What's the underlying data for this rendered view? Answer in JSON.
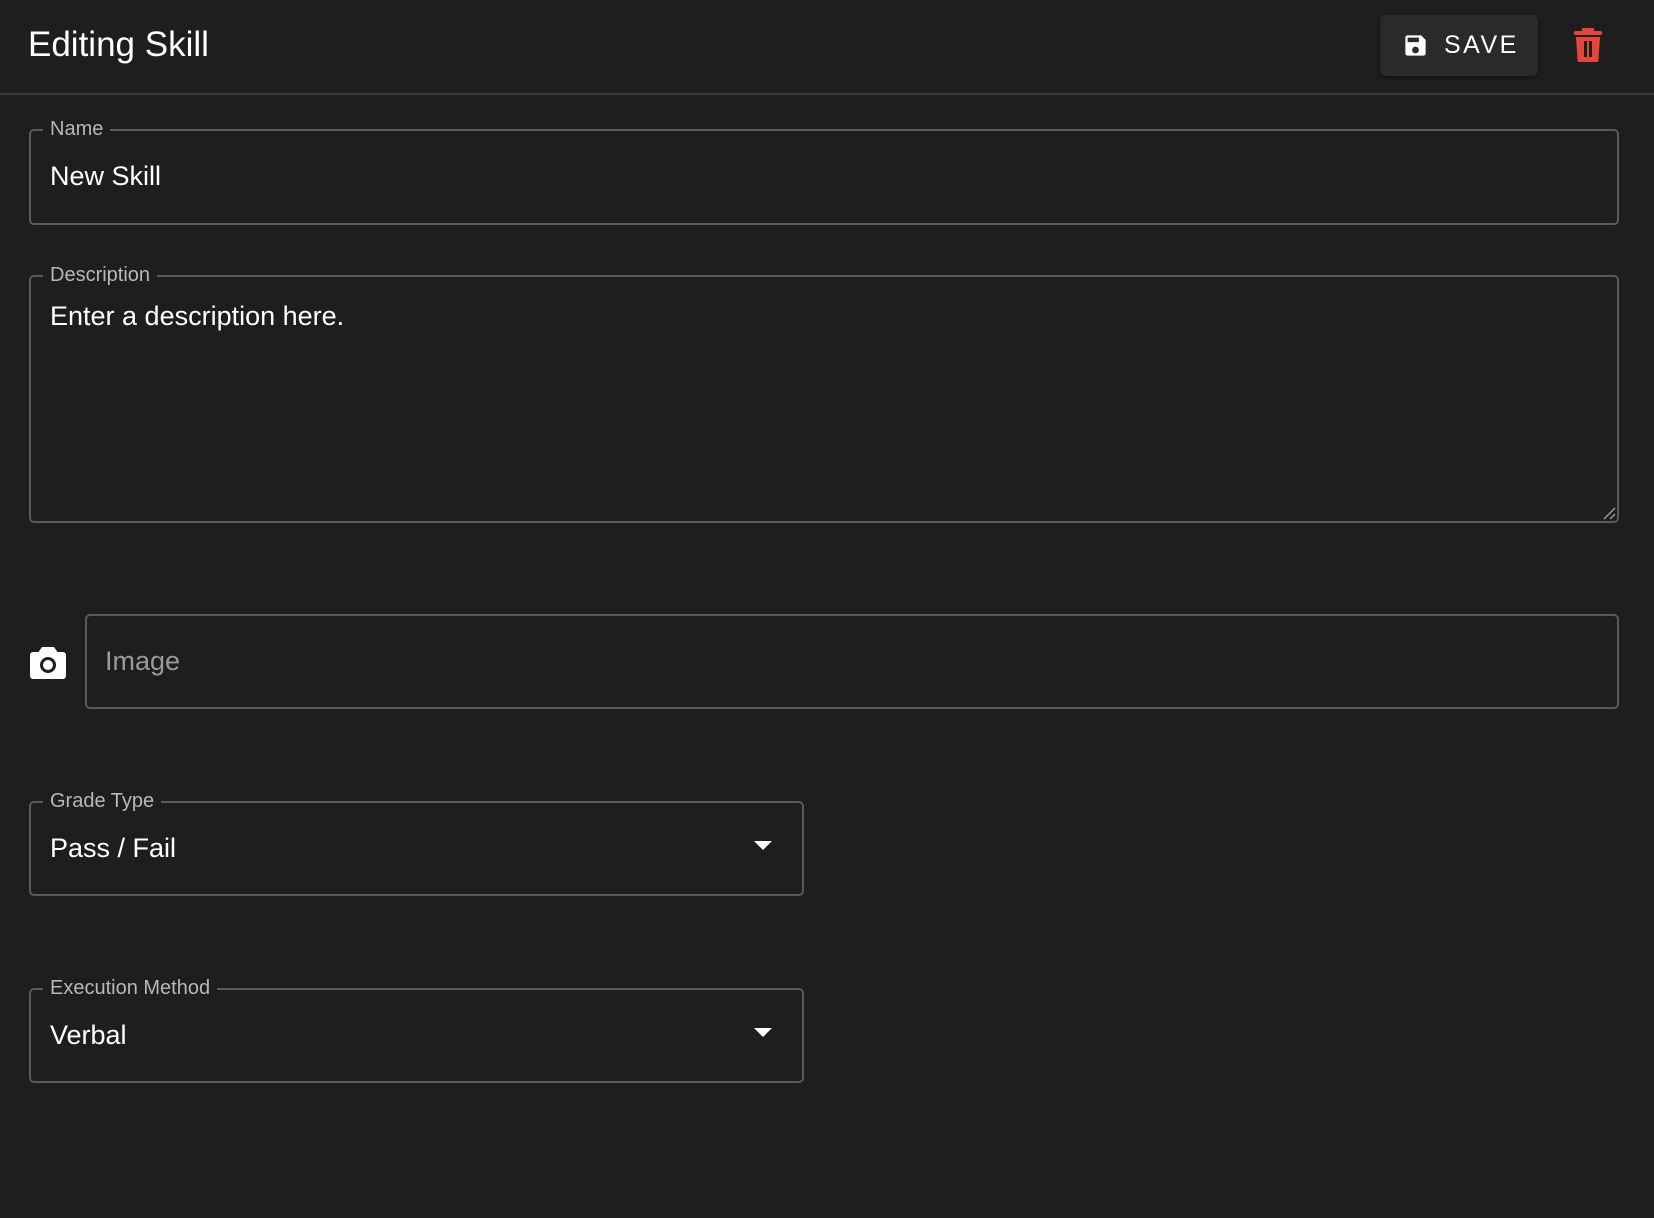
{
  "header": {
    "title": "Editing Skill",
    "save_label": "SAVE",
    "save_icon": "floppy-disk-icon",
    "delete_icon": "trash-icon",
    "delete_color": "#e5463b"
  },
  "form": {
    "name": {
      "label": "Name",
      "value": "New Skill"
    },
    "description": {
      "label": "Description",
      "value": "Enter a description here."
    },
    "image": {
      "placeholder": "Image",
      "icon": "camera-icon"
    },
    "grade_type": {
      "label": "Grade Type",
      "value": "Pass / Fail"
    },
    "execution_method": {
      "label": "Execution Method",
      "value": "Verbal"
    }
  }
}
